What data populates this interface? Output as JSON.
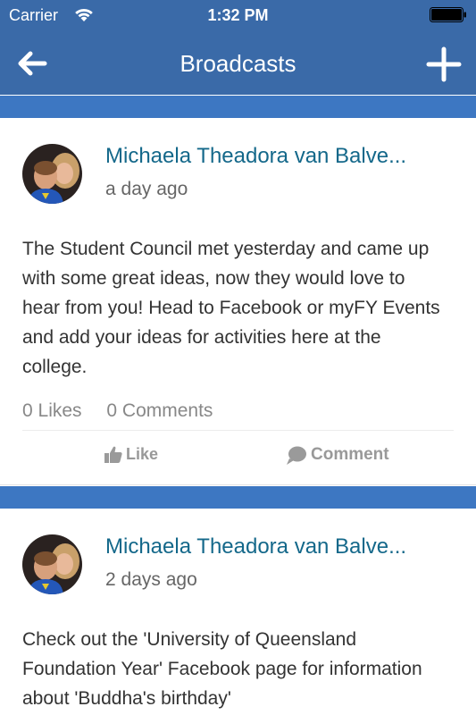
{
  "status_bar": {
    "carrier": "Carrier",
    "time": "1:32 PM"
  },
  "nav": {
    "title": "Broadcasts",
    "back_icon": "arrow-left-icon",
    "add_icon": "plus-icon"
  },
  "colors": {
    "header": "#3a6aa8",
    "band": "#3d77c2",
    "author": "#14688a"
  },
  "posts": [
    {
      "author": "Michaela Theadora van Balve...",
      "time_ago": "a day ago",
      "text": "The Student Council met yesterday and came up with some great ideas, now they would love to hear from you! Head to Facebook or myFY Events and add your ideas for activities here at the college.",
      "likes": "0 Likes",
      "comments": "0 Comments",
      "like_label": "Like",
      "comment_label": "Comment"
    },
    {
      "author": "Michaela Theadora van Balve...",
      "time_ago": "2 days ago",
      "text": "Check out the 'University of Queensland Foundation Year' Facebook page for information about 'Buddha's birthday'"
    }
  ]
}
